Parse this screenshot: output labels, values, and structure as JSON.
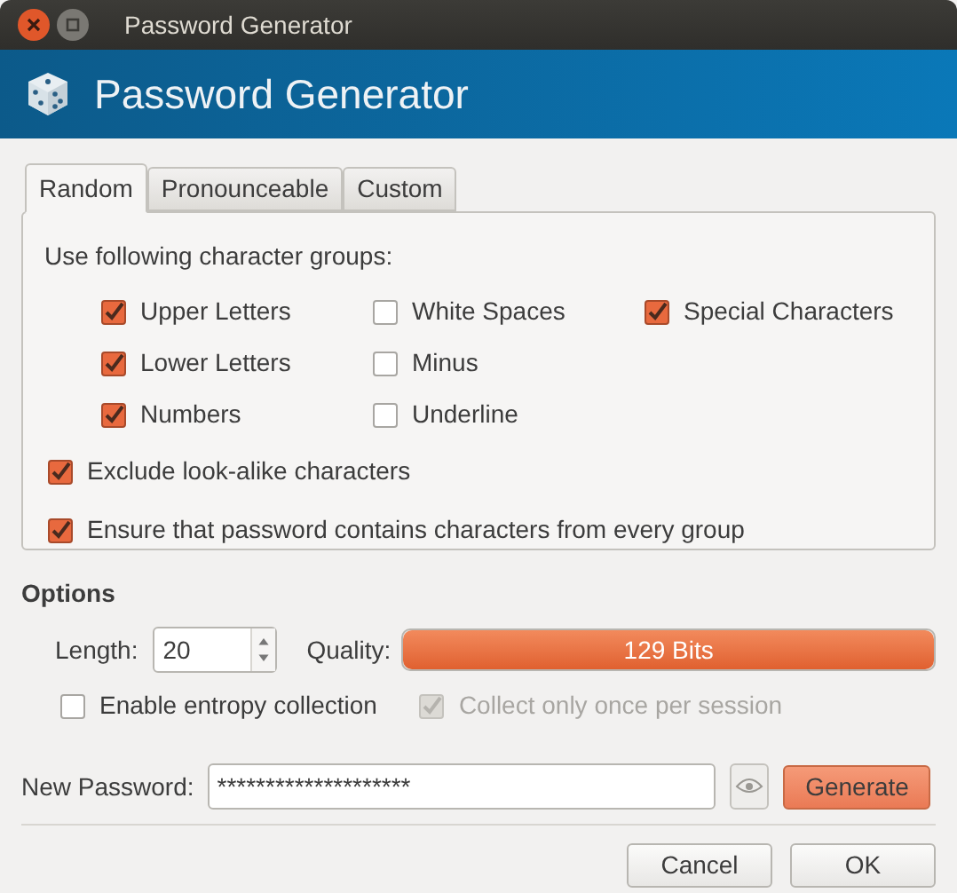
{
  "window": {
    "title": "Password Generator"
  },
  "header": {
    "title": "Password Generator"
  },
  "tabs": [
    {
      "label": "Random",
      "selected": true
    },
    {
      "label": "Pronounceable",
      "selected": false
    },
    {
      "label": "Custom",
      "selected": false
    }
  ],
  "groups_label": "Use following character groups:",
  "groups": [
    {
      "label": "Upper Letters",
      "checked": true
    },
    {
      "label": "White Spaces",
      "checked": false
    },
    {
      "label": "Special Characters",
      "checked": true
    },
    {
      "label": "Lower Letters",
      "checked": true
    },
    {
      "label": "Minus",
      "checked": false
    },
    {
      "label": "Numbers",
      "checked": true
    },
    {
      "label": "Underline",
      "checked": false
    }
  ],
  "extra_options": [
    {
      "label": "Exclude look-alike characters",
      "checked": true
    },
    {
      "label": "Ensure that password contains characters from every group",
      "checked": true
    }
  ],
  "options": {
    "title": "Options",
    "length_label": "Length:",
    "length": "20",
    "quality_label": "Quality:",
    "quality": {
      "level": 1,
      "reading": "129 Bits"
    },
    "entropy": {
      "label": "Enable entropy collection",
      "checked": false,
      "disabled": false
    },
    "collect_once": {
      "label": "Collect only once per session",
      "checked": true,
      "disabled": true
    }
  },
  "new_password": {
    "label": "New Password:",
    "value": "********************",
    "generate": "Generate"
  },
  "buttons": [
    "Cancel",
    "OK"
  ]
}
